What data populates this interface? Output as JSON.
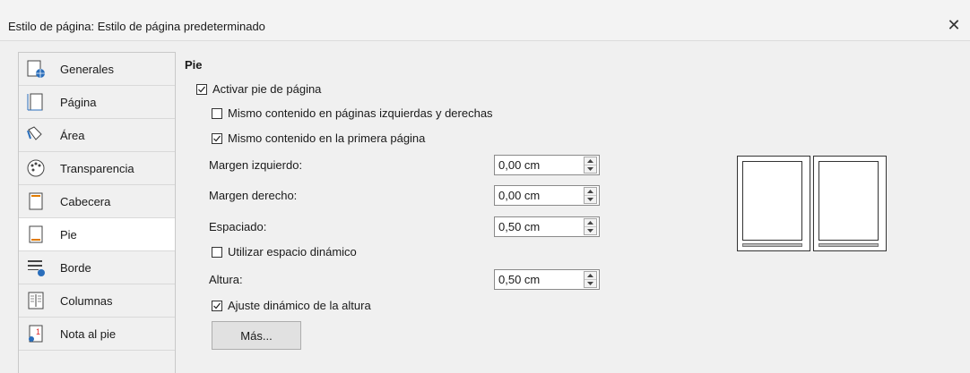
{
  "window": {
    "title": "Estilo de página: Estilo de página predeterminado",
    "close_glyph": "✕"
  },
  "sidebar": {
    "items": [
      {
        "label": "Generales",
        "icon": "globe-page-icon"
      },
      {
        "label": "Página",
        "icon": "page-icon"
      },
      {
        "label": "Área",
        "icon": "paint-bucket-icon"
      },
      {
        "label": "Transparencia",
        "icon": "palette-icon"
      },
      {
        "label": "Cabecera",
        "icon": "header-page-icon"
      },
      {
        "label": "Pie",
        "icon": "footer-page-icon"
      },
      {
        "label": "Borde",
        "icon": "border-icon"
      },
      {
        "label": "Columnas",
        "icon": "columns-icon"
      },
      {
        "label": "Nota al pie",
        "icon": "footnote-icon"
      }
    ],
    "selected": "Pie"
  },
  "footer": {
    "section_title": "Pie",
    "activate": {
      "label": "Activar pie de página",
      "checked": true
    },
    "same_left_right": {
      "label": "Mismo contenido en páginas izquierdas y derechas",
      "checked": false
    },
    "same_first": {
      "label": "Mismo contenido en la primera página",
      "checked": true
    },
    "left_margin": {
      "label": "Margen izquierdo:",
      "value": "0,00 cm"
    },
    "right_margin": {
      "label": "Margen derecho:",
      "value": "0,00 cm"
    },
    "spacing": {
      "label": "Espaciado:",
      "value": "0,50 cm"
    },
    "dynamic_spacing": {
      "label": "Utilizar espacio dinámico",
      "checked": false
    },
    "height": {
      "label": "Altura:",
      "value": "0,50 cm"
    },
    "autofit_height": {
      "label": "Ajuste dinámico de la altura",
      "checked": true
    },
    "more_button": "Más..."
  },
  "colors": {
    "check_mark": "#1a1a1a",
    "icon_blue": "#2a6ebb",
    "icon_orange": "#e07b00"
  }
}
